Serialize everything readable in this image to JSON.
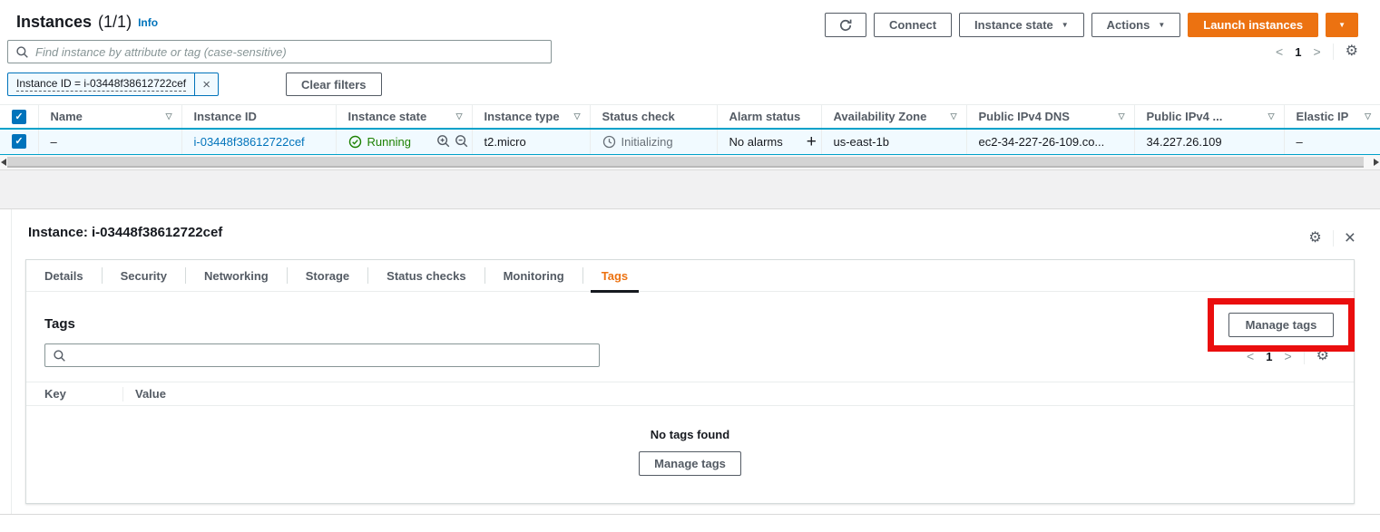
{
  "header": {
    "title": "Instances",
    "count": "(1/1)",
    "info_link": "Info"
  },
  "toolbar": {
    "connect": "Connect",
    "instance_state": "Instance state",
    "actions": "Actions",
    "launch_instances": "Launch instances"
  },
  "filter_bar": {
    "search_placeholder": "Find instance by attribute or tag (case-sensitive)",
    "filter_token": "Instance ID = i-03448f38612722cef",
    "clear_filters": "Clear filters"
  },
  "pagination": {
    "page": "1"
  },
  "instances_table": {
    "columns": [
      {
        "label": "Name"
      },
      {
        "label": "Instance ID"
      },
      {
        "label": "Instance state"
      },
      {
        "label": "Instance type"
      },
      {
        "label": "Status check"
      },
      {
        "label": "Alarm status"
      },
      {
        "label": "Availability Zone"
      },
      {
        "label": "Public IPv4 DNS"
      },
      {
        "label": "Public IPv4 ..."
      },
      {
        "label": "Elastic IP"
      }
    ],
    "row": {
      "name": "–",
      "instance_id": "i-03448f38612722cef",
      "state": "Running",
      "type": "t2.micro",
      "status_check": "Initializing",
      "alarm_status": "No alarms",
      "az": "us-east-1b",
      "public_dns": "ec2-34-227-26-109.co...",
      "public_ip": "34.227.26.109",
      "elastic_ip": "–"
    }
  },
  "detail_panel": {
    "heading": "Instance: i-03448f38612722cef",
    "tabs": [
      "Details",
      "Security",
      "Networking",
      "Storage",
      "Status checks",
      "Monitoring",
      "Tags"
    ],
    "active_tab": "Tags",
    "tags_panel": {
      "title": "Tags",
      "manage_tags": "Manage tags",
      "key_column": "Key",
      "value_column": "Value",
      "empty_message": "No tags found",
      "page": "1"
    }
  },
  "icons": {
    "sort": "▽",
    "caret": "▼",
    "gear": "⚙",
    "close": "×",
    "chevron_left": "<",
    "chevron_right": ">",
    "plus": "+",
    "check": "✓"
  },
  "colors": {
    "accent_orange": "#ec7211",
    "link_blue": "#0073bb",
    "running_green": "#1d8102",
    "selected_row_bg": "#f1faff",
    "selected_row_border": "#00a1c9",
    "highlight_red": "#ea0e0e"
  }
}
